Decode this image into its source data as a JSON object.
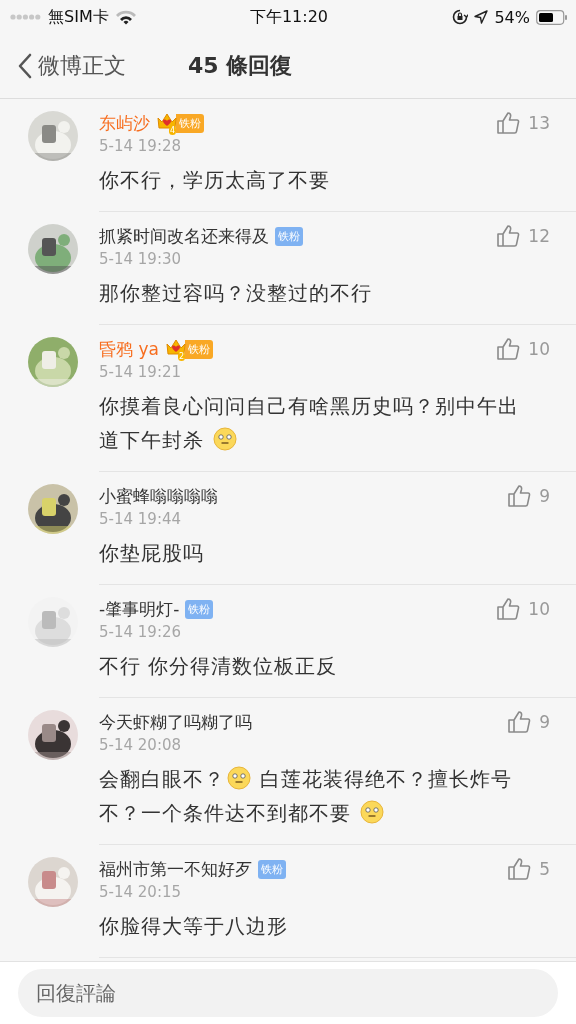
{
  "status_bar": {
    "carrier": "無SIM卡",
    "time": "下午11:20",
    "battery": "54%"
  },
  "nav": {
    "back": "微博正文",
    "title": "45 條回復"
  },
  "comments": [
    {
      "name": "东屿沙",
      "highlighted": true,
      "badge": {
        "kind": "crown",
        "level": "4",
        "label": "铁粉"
      },
      "time": "5-14 19:28",
      "likes": "13",
      "body": [
        {
          "kind": "text",
          "text": "你不行，学历太高了不要"
        }
      ]
    },
    {
      "name": "抓紧时间改名还来得及",
      "highlighted": false,
      "badge": {
        "kind": "plain",
        "label": "铁粉"
      },
      "time": "5-14 19:30",
      "likes": "12",
      "body": [
        {
          "kind": "text",
          "text": "那你整过容吗？没整过的不行"
        }
      ]
    },
    {
      "name": "昏鸦 ya",
      "highlighted": true,
      "badge": {
        "kind": "crown",
        "level": "2",
        "label": "铁粉"
      },
      "time": "5-14 19:21",
      "likes": "10",
      "body": [
        {
          "kind": "text",
          "text": "你摸着良心问问自己有啥黑历史吗？别中午出道下午封杀 "
        },
        {
          "kind": "emoji"
        }
      ]
    },
    {
      "name": "小蜜蜂嗡嗡嗡嗡",
      "highlighted": false,
      "time": "5-14 19:44",
      "likes": "9",
      "body": [
        {
          "kind": "text",
          "text": "你垫屁股吗"
        }
      ]
    },
    {
      "name": "-肇事明灯-",
      "highlighted": false,
      "badge": {
        "kind": "plain",
        "label": "铁粉"
      },
      "time": "5-14 19:26",
      "likes": "10",
      "body": [
        {
          "kind": "text",
          "text": "不行 你分得清数位板正反"
        }
      ]
    },
    {
      "name": "今天虾糊了吗糊了吗",
      "highlighted": false,
      "time": "5-14 20:08",
      "likes": "9",
      "body": [
        {
          "kind": "text",
          "text": "会翻白眼不？"
        },
        {
          "kind": "emoji"
        },
        {
          "kind": "text",
          "text": " 白莲花装得绝不？擅长炸号不？一个条件达不到都不要 "
        },
        {
          "kind": "emoji"
        }
      ]
    },
    {
      "name": "福州市第一不知好歹",
      "highlighted": false,
      "badge": {
        "kind": "plain",
        "label": "铁粉"
      },
      "time": "5-14 20:15",
      "likes": "5",
      "body": [
        {
          "kind": "text",
          "text": "你脸得大等于八边形"
        }
      ]
    }
  ],
  "reply_field": {
    "placeholder": "回復評論"
  }
}
